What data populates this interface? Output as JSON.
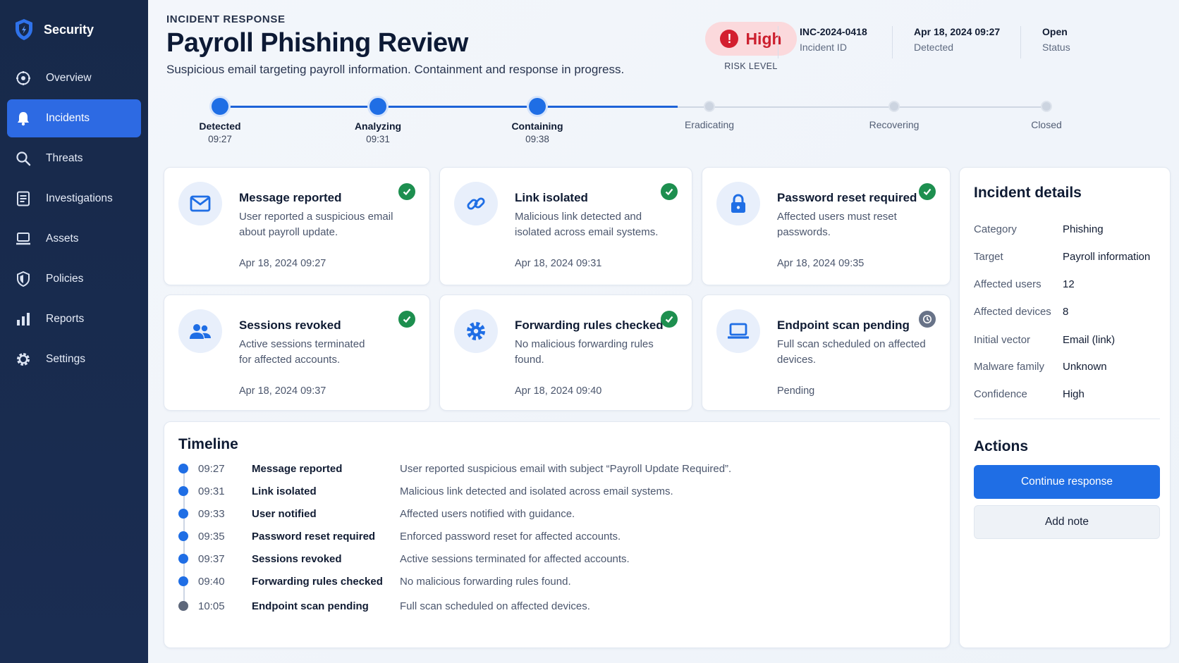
{
  "sidebar": {
    "brand": "Security",
    "items": [
      {
        "label": "Overview",
        "icon": "overview-icon",
        "active": false
      },
      {
        "label": "Incidents",
        "icon": "bell-icon",
        "active": true
      },
      {
        "label": "Threats",
        "icon": "search-icon",
        "active": false
      },
      {
        "label": "Investigations",
        "icon": "document-icon",
        "active": false
      },
      {
        "label": "Assets",
        "icon": "laptop-icon",
        "active": false
      },
      {
        "label": "Policies",
        "icon": "shield-icon",
        "active": false
      },
      {
        "label": "Reports",
        "icon": "bar-chart-icon",
        "active": false
      },
      {
        "label": "Settings",
        "icon": "gear-icon",
        "active": false
      }
    ]
  },
  "header": {
    "eyebrow": "INCIDENT RESPONSE",
    "title": "Payroll Phishing Review",
    "subtitle": "Suspicious email targeting payroll information. Containment and response in progress.",
    "risk": {
      "value": "High",
      "label": "RISK LEVEL",
      "color": "#cc1f2e"
    },
    "meta": [
      {
        "value": "INC-2024-0418",
        "label": "Incident ID"
      },
      {
        "value": "Apr 18, 2024 09:27",
        "label": "Detected"
      },
      {
        "value": "Open",
        "label": "Status"
      }
    ]
  },
  "progress": {
    "steps": [
      {
        "label": "Detected",
        "time": "09:27",
        "done": true
      },
      {
        "label": "Analyzing",
        "time": "09:31",
        "done": true
      },
      {
        "label": "Containing",
        "time": "09:38",
        "done": true
      },
      {
        "label": "Eradicating",
        "time": "",
        "done": false
      },
      {
        "label": "Recovering",
        "time": "",
        "done": false
      },
      {
        "label": "Closed",
        "time": "",
        "done": false
      }
    ]
  },
  "cards": [
    {
      "title": "Message reported",
      "desc": "User reported a suspicious email about payroll update.",
      "time": "Apr 18, 2024 09:27",
      "icon": "mail-icon",
      "status": "complete"
    },
    {
      "title": "Link isolated",
      "desc": "Malicious link detected and isolated across email systems.",
      "time": "Apr 18, 2024 09:31",
      "icon": "link-icon",
      "status": "complete"
    },
    {
      "title": "Password reset required",
      "desc": "Affected users must reset passwords.",
      "time": "Apr 18, 2024 09:35",
      "icon": "lock-icon",
      "status": "complete"
    },
    {
      "title": "Sessions revoked",
      "desc": "Active sessions terminated for affected accounts.",
      "time": "Apr 18, 2024 09:37",
      "icon": "users-icon",
      "status": "complete"
    },
    {
      "title": "Forwarding rules checked",
      "desc": "No malicious forwarding rules found.",
      "time": "Apr 18, 2024 09:40",
      "icon": "gear-icon",
      "status": "complete"
    },
    {
      "title": "Endpoint scan pending",
      "desc": "Full scan scheduled on affected devices.",
      "time": "Pending",
      "icon": "laptop-icon",
      "status": "pending"
    }
  ],
  "timeline": {
    "title": "Timeline",
    "events": [
      {
        "time": "09:27",
        "event": "Message reported",
        "detail": "User reported suspicious email with subject “Payroll Update Required”.",
        "pending": false
      },
      {
        "time": "09:31",
        "event": "Link isolated",
        "detail": "Malicious link detected and isolated across email systems.",
        "pending": false
      },
      {
        "time": "09:33",
        "event": "User notified",
        "detail": "Affected users notified with guidance.",
        "pending": false
      },
      {
        "time": "09:35",
        "event": "Password reset required",
        "detail": "Enforced password reset for affected accounts.",
        "pending": false
      },
      {
        "time": "09:37",
        "event": "Sessions revoked",
        "detail": "Active sessions terminated for affected accounts.",
        "pending": false
      },
      {
        "time": "09:40",
        "event": "Forwarding rules checked",
        "detail": "No malicious forwarding rules found.",
        "pending": false
      },
      {
        "time": "10:05",
        "event": "Endpoint scan pending",
        "detail": "Full scan scheduled on affected devices.",
        "pending": true
      }
    ]
  },
  "details": {
    "title": "Incident details",
    "rows": [
      {
        "key": "Category",
        "value": "Phishing"
      },
      {
        "key": "Target",
        "value": "Payroll information"
      },
      {
        "key": "Affected users",
        "value": "12"
      },
      {
        "key": "Affected devices",
        "value": "8"
      },
      {
        "key": "Initial vector",
        "value": "Email (link)"
      },
      {
        "key": "Malware family",
        "value": "Unknown"
      },
      {
        "key": "Confidence",
        "value": "High"
      }
    ]
  },
  "actions": {
    "title": "Actions",
    "primary": "Continue response",
    "secondary": "Add note"
  }
}
